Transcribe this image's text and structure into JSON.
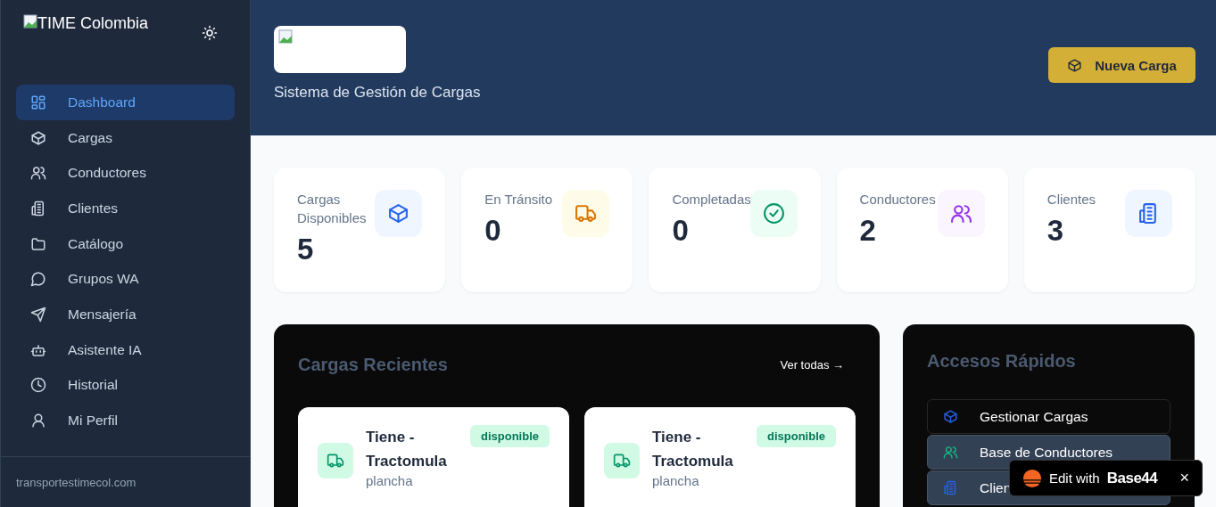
{
  "sidebar": {
    "brand": "TIME Colombia",
    "items": [
      {
        "label": "Dashboard",
        "selected": true
      },
      {
        "label": "Cargas",
        "selected": false
      },
      {
        "label": "Conductores",
        "selected": false
      },
      {
        "label": "Clientes",
        "selected": false
      },
      {
        "label": "Catálogo",
        "selected": false
      },
      {
        "label": "Grupos WA",
        "selected": false
      },
      {
        "label": "Mensajería",
        "selected": false
      },
      {
        "label": "Asistente IA",
        "selected": false
      },
      {
        "label": "Historial",
        "selected": false
      },
      {
        "label": "Mi Perfil",
        "selected": false
      }
    ],
    "footer": "transportestimecol.com"
  },
  "header": {
    "subtitle": "Sistema de Gestión de Cargas",
    "button": "Nueva Carga"
  },
  "stats": [
    {
      "label": "Cargas Disponibles",
      "value": "5"
    },
    {
      "label": "En Tránsito",
      "value": "0"
    },
    {
      "label": "Completadas",
      "value": "0"
    },
    {
      "label": "Conductores",
      "value": "2"
    },
    {
      "label": "Clientes",
      "value": "3"
    }
  ],
  "recent": {
    "title": "Cargas Recientes",
    "link": "Ver todas →",
    "cards": [
      {
        "title": "Tiene - Tractomula",
        "subtitle": "plancha",
        "status": "disponible"
      },
      {
        "title": "Tiene - Tractomula",
        "subtitle": "plancha",
        "status": "disponible"
      }
    ]
  },
  "quick": {
    "title": "Accesos Rápidos",
    "items": [
      {
        "label": "Gestionar Cargas",
        "kind": "outline"
      },
      {
        "label": "Base de Conductores",
        "kind": "filled"
      },
      {
        "label": "Clien",
        "kind": "filled"
      }
    ]
  },
  "badge": {
    "text": "Edit with",
    "brand": "Base44",
    "close": "×"
  }
}
